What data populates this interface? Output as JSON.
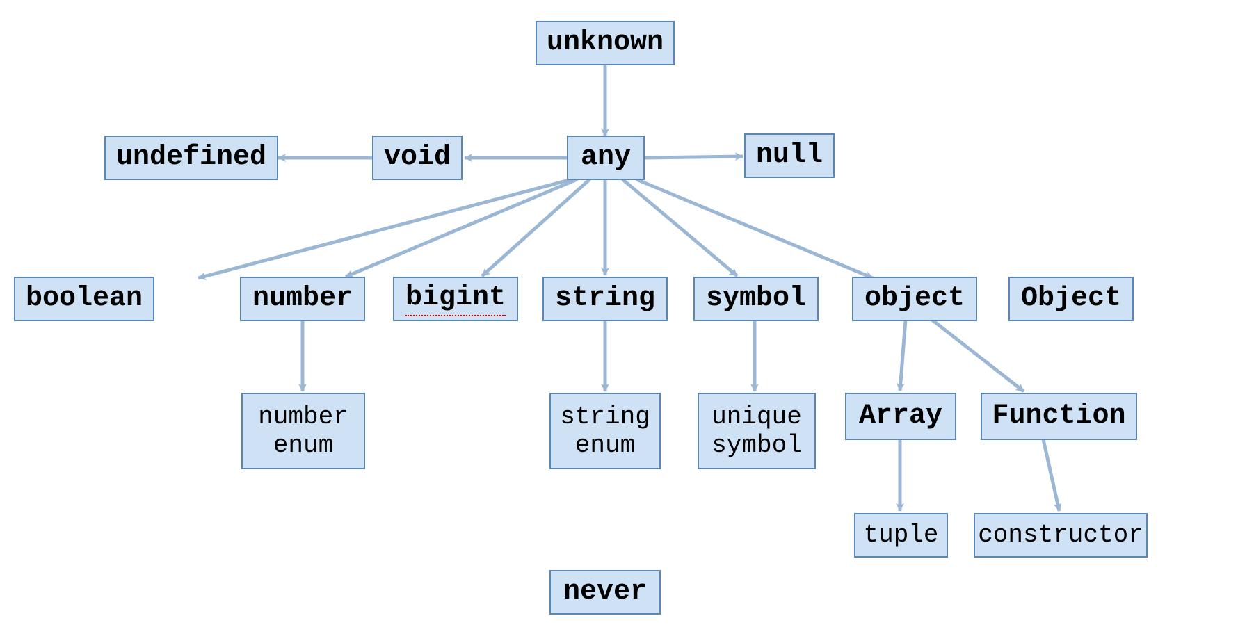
{
  "colors": {
    "node_fill": "#cfe1f4",
    "node_border": "#5c87b2",
    "arrow": "#9cb7d4",
    "text": "#000000",
    "spellcheck_underline": "#cc0000"
  },
  "nodes": {
    "unknown": {
      "label": "unknown",
      "bold": true,
      "spellcheck": false
    },
    "any": {
      "label": "any",
      "bold": true,
      "spellcheck": false
    },
    "undefined": {
      "label": "undefined",
      "bold": true,
      "spellcheck": false
    },
    "void": {
      "label": "void",
      "bold": true,
      "spellcheck": false
    },
    "null": {
      "label": "null",
      "bold": true,
      "spellcheck": false
    },
    "boolean": {
      "label": "boolean",
      "bold": true,
      "spellcheck": false
    },
    "number": {
      "label": "number",
      "bold": true,
      "spellcheck": false
    },
    "bigint": {
      "label": "bigint",
      "bold": true,
      "spellcheck": true
    },
    "string": {
      "label": "string",
      "bold": true,
      "spellcheck": false
    },
    "symbol": {
      "label": "symbol",
      "bold": true,
      "spellcheck": false
    },
    "object_lc": {
      "label": "object",
      "bold": true,
      "spellcheck": false
    },
    "object_uc": {
      "label": "Object",
      "bold": true,
      "spellcheck": false
    },
    "number_enum": {
      "label": "number\nenum",
      "bold": false,
      "spellcheck": false
    },
    "string_enum": {
      "label": "string\nenum",
      "bold": false,
      "spellcheck": false
    },
    "unique_symbol": {
      "label": "unique\nsymbol",
      "bold": false,
      "spellcheck": false
    },
    "array": {
      "label": "Array",
      "bold": true,
      "spellcheck": false
    },
    "function": {
      "label": "Function",
      "bold": true,
      "spellcheck": false
    },
    "tuple": {
      "label": "tuple",
      "bold": false,
      "spellcheck": false
    },
    "constructor": {
      "label": "constructor",
      "bold": false,
      "spellcheck": false
    },
    "never": {
      "label": "never",
      "bold": true,
      "spellcheck": false
    }
  },
  "edges": [
    {
      "from": "unknown",
      "to": "any"
    },
    {
      "from": "any",
      "to": "void"
    },
    {
      "from": "void",
      "to": "undefined"
    },
    {
      "from": "any",
      "to": "null"
    },
    {
      "from": "any",
      "to": "boolean"
    },
    {
      "from": "any",
      "to": "number"
    },
    {
      "from": "any",
      "to": "bigint"
    },
    {
      "from": "any",
      "to": "string"
    },
    {
      "from": "any",
      "to": "symbol"
    },
    {
      "from": "any",
      "to": "object_lc"
    },
    {
      "from": "number",
      "to": "number_enum"
    },
    {
      "from": "string",
      "to": "string_enum"
    },
    {
      "from": "symbol",
      "to": "unique_symbol"
    },
    {
      "from": "object_lc",
      "to": "array"
    },
    {
      "from": "object_lc",
      "to": "function"
    },
    {
      "from": "array",
      "to": "tuple"
    },
    {
      "from": "function",
      "to": "constructor"
    }
  ]
}
